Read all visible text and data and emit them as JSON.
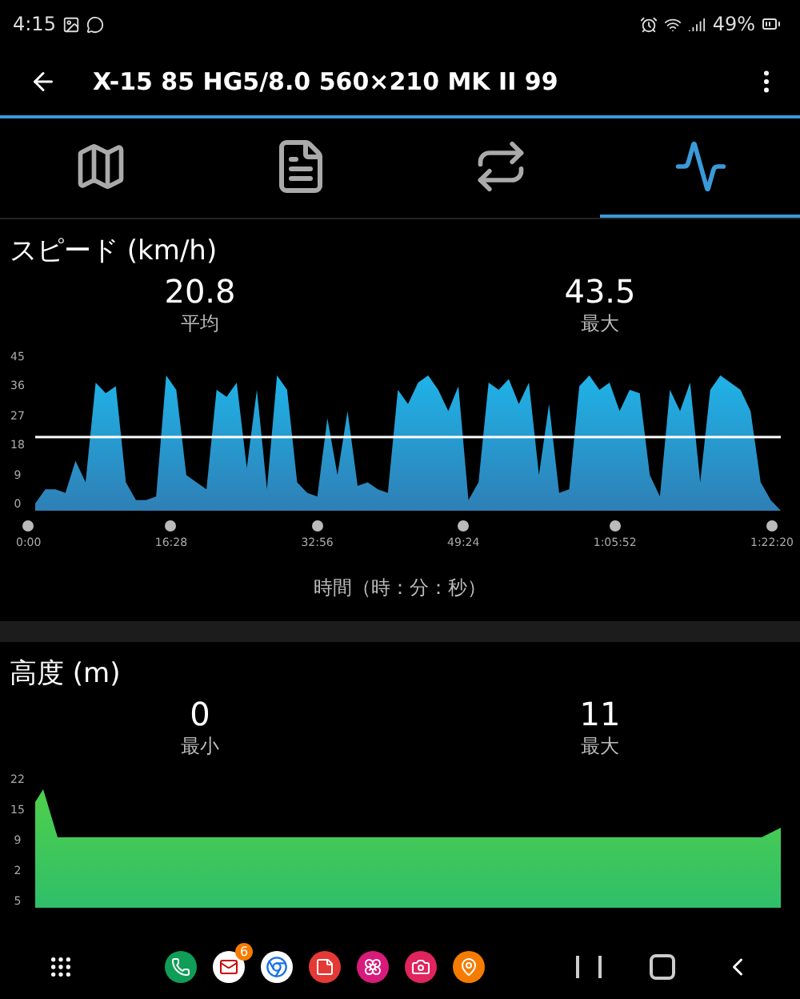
{
  "status_bar": {
    "time": "4:15",
    "battery": "49%"
  },
  "app_bar": {
    "title": "X-15 85 HG5/8.0 560×210 MK II 99"
  },
  "tabs": [
    {
      "kind": "map",
      "selected": false
    },
    {
      "kind": "document",
      "selected": false
    },
    {
      "kind": "loop",
      "selected": false
    },
    {
      "kind": "graph",
      "selected": true
    }
  ],
  "speed": {
    "title": "スピード (km/h)",
    "stats": [
      {
        "value": "20.8",
        "label": "平均"
      },
      {
        "value": "43.5",
        "label": "最大"
      }
    ],
    "yticks": [
      "45",
      "36",
      "27",
      "18",
      "9",
      "0"
    ],
    "xticks": [
      "0:00",
      "16:28",
      "32:56",
      "49:24",
      "1:05:52",
      "1:22:20"
    ],
    "xlabel": "時間（時：分：秒）"
  },
  "altitude": {
    "title": "高度 (m)",
    "stats": [
      {
        "value": "0",
        "label": "最小"
      },
      {
        "value": "11",
        "label": "最大"
      }
    ],
    "yticks": [
      "22",
      "15",
      "9",
      "2",
      "5"
    ]
  },
  "nav_bar": {
    "apps": [
      {
        "kind": "phone",
        "color": "#0f9d58"
      },
      {
        "kind": "mail",
        "color": "#ffffff",
        "badge": "6"
      },
      {
        "kind": "browser",
        "color": "#ffffff"
      },
      {
        "kind": "notes",
        "color": "#e53935"
      },
      {
        "kind": "flower",
        "color": "#d81b7a"
      },
      {
        "kind": "camera",
        "color": "#e0245e"
      },
      {
        "kind": "pin",
        "color": "#f57c00"
      }
    ]
  }
}
